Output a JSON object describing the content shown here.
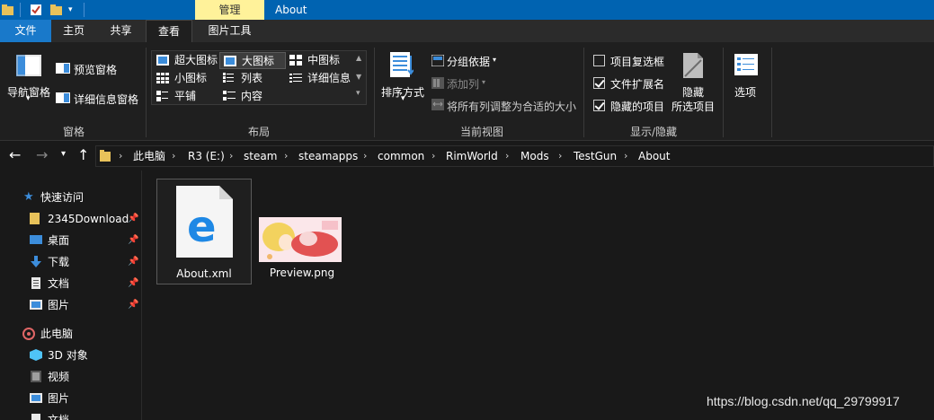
{
  "titlebar": {
    "context_tab": "管理",
    "title": "About"
  },
  "tabs": {
    "file": "文件",
    "home": "主页",
    "share": "共享",
    "view": "查看",
    "picture_tools": "图片工具"
  },
  "ribbon": {
    "pane": {
      "nav_pane": "导航窗格",
      "preview_pane": "预览窗格",
      "details_pane": "详细信息窗格",
      "group": "窗格"
    },
    "layout": {
      "extra_large": "超大图标",
      "large": "大图标",
      "medium": "中图标",
      "small": "小图标",
      "list": "列表",
      "details": "详细信息",
      "tiles": "平铺",
      "content": "内容",
      "group": "布局"
    },
    "current_view": {
      "sort_by": "排序方式",
      "group_by": "分组依据",
      "add_columns": "添加列",
      "size_all_columns": "将所有列调整为合适的大小",
      "group": "当前视图"
    },
    "show_hide": {
      "item_checkboxes": "项目复选框",
      "item_checkboxes_checked": false,
      "file_extensions": "文件扩展名",
      "file_extensions_checked": true,
      "hidden_items": "隐藏的项目",
      "hidden_items_checked": true,
      "hide_selected_1": "隐藏",
      "hide_selected_2": "所选项目",
      "group": "显示/隐藏"
    },
    "options": "选项"
  },
  "address": {
    "crumbs": [
      "此电脑",
      "R3 (E:)",
      "steam",
      "steamapps",
      "common",
      "RimWorld",
      "Mods",
      "TestGun",
      "About"
    ]
  },
  "nav": {
    "quick_access": "快速访问",
    "items": [
      "2345Download",
      "桌面",
      "下载",
      "文档",
      "图片"
    ],
    "this_pc": "此电脑",
    "pc_items": [
      "3D 对象",
      "视频",
      "图片",
      "文档"
    ]
  },
  "files": [
    {
      "name": "About.xml",
      "icon": "edge-document-icon"
    },
    {
      "name": "Preview.png",
      "icon": "image-thumbnail"
    }
  ],
  "watermark": "https://blog.csdn.net/qq_29799917",
  "colors": {
    "titlebar": "#0063b1",
    "file_tab": "#1979ca",
    "context_tab": "#fff29a",
    "background": "#191919"
  }
}
